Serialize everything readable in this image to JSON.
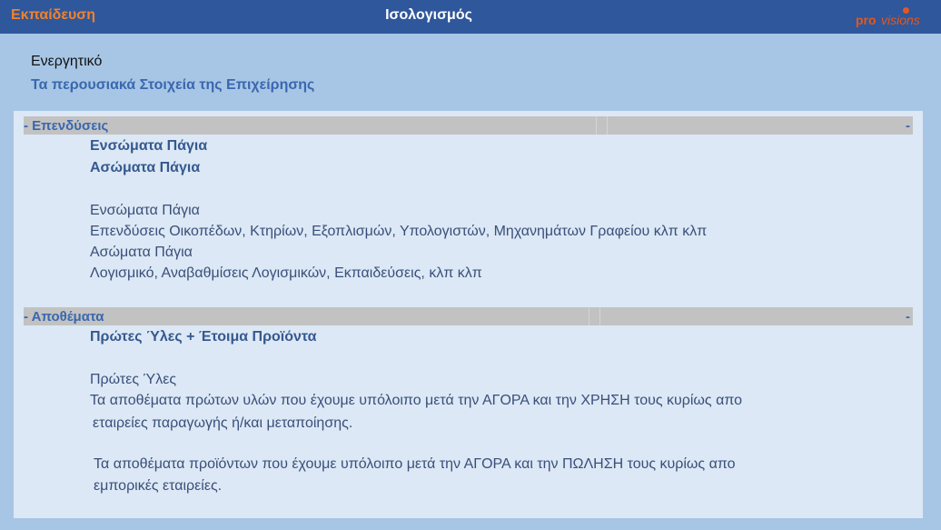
{
  "header": {
    "left_title": "Εκπαίδευση",
    "center_title": "Ισολογισμός",
    "logo_pro": "pro",
    "logo_visions": "visions"
  },
  "intro": {
    "title": "Ενεργητικό",
    "subtitle": "Τα περουσιακά Στοιχεία της Επιχείρησης"
  },
  "sections": [
    {
      "toggle_label": "- Επενδύσεις",
      "right_dash": "-",
      "bold_items": [
        "Ενσώματα Πάγια",
        "Ασώματα Πάγια"
      ],
      "details": [
        "Ενσώματα Πάγια",
        "Επενδύσεις Οικοπέδων, Κτηρίων, Εξοπλισμών, Υπολογιστών, Μηχανημάτων Γραφείου κλπ κλπ",
        "Ασώματα Πάγια",
        "Λογισμικό, Αναβαθμίσεις Λογισμικών, Εκπαιδεύσεις, κλπ κλπ"
      ]
    },
    {
      "toggle_label": "- Αποθέματα",
      "right_dash": "-",
      "bold_items": [
        "Πρώτες Ύλες + Έτοιμα Προϊόντα"
      ],
      "details": [
        "Πρώτες Ύλες",
        "Τα αποθέματα πρώτων υλών που έχουμε υπόλοιπο μετά την ΑΓΟΡΑ και την ΧΡΗΣΗ τους κυρίως απο",
        "εταιρείες παραγωγής ή/και μεταποίησης.",
        "Τα αποθέματα προϊόντων που έχουμε υπόλοιπο μετά την ΑΓΟΡΑ και την ΠΩΛΗΣΗ τους κυρίως απο",
        "εμπορικές εταιρείες."
      ]
    }
  ],
  "colors": {
    "topbar": "#2f579b",
    "accent_orange": "#f0822c",
    "background": "#a7c6e6",
    "panel": "#dce8f5",
    "section_bar": "#c2c2c2",
    "text_blue": "#3a67ae"
  }
}
